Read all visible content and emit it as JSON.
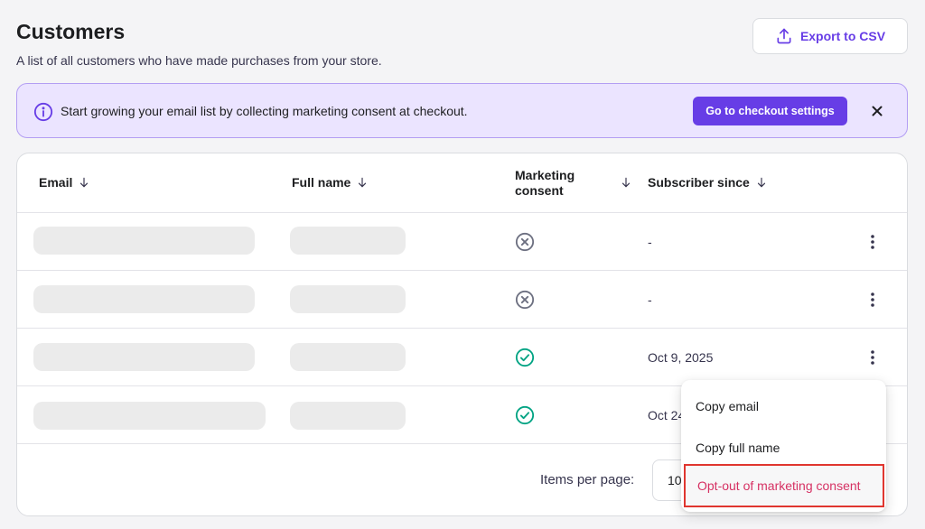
{
  "header": {
    "title": "Customers",
    "subtitle": "A list of all customers who have made purchases from your store.",
    "export_label": "Export to CSV"
  },
  "banner": {
    "text": "Start growing your email list by collecting marketing consent at checkout.",
    "button_label": "Go to checkout settings"
  },
  "table": {
    "columns": {
      "email": "Email",
      "full_name": "Full name",
      "marketing_consent": "Marketing consent",
      "subscriber_since": "Subscriber since"
    },
    "rows": [
      {
        "consent": "declined",
        "subscriber_since": "-"
      },
      {
        "consent": "declined",
        "subscriber_since": "-"
      },
      {
        "consent": "granted",
        "subscriber_since": "Oct 9, 2025"
      },
      {
        "consent": "granted",
        "subscriber_since": "Oct 24"
      }
    ],
    "footer": {
      "items_per_page_label": "Items per page:",
      "items_per_page_value": "10"
    }
  },
  "context_menu": {
    "items": [
      "Copy email",
      "Copy full name",
      "Opt-out of marketing consent"
    ]
  },
  "colors": {
    "accent": "#673de6",
    "banner_bg": "#ebe4ff",
    "success": "#00b090",
    "danger": "#d63163",
    "highlight_border": "#e0362f"
  },
  "icons": {
    "export": "upload-icon",
    "info": "info-circle-icon",
    "close": "close-icon",
    "sort": "arrow-down-icon",
    "declined": "x-circle-icon",
    "granted": "check-circle-icon",
    "row_actions": "kebab-menu-icon"
  }
}
